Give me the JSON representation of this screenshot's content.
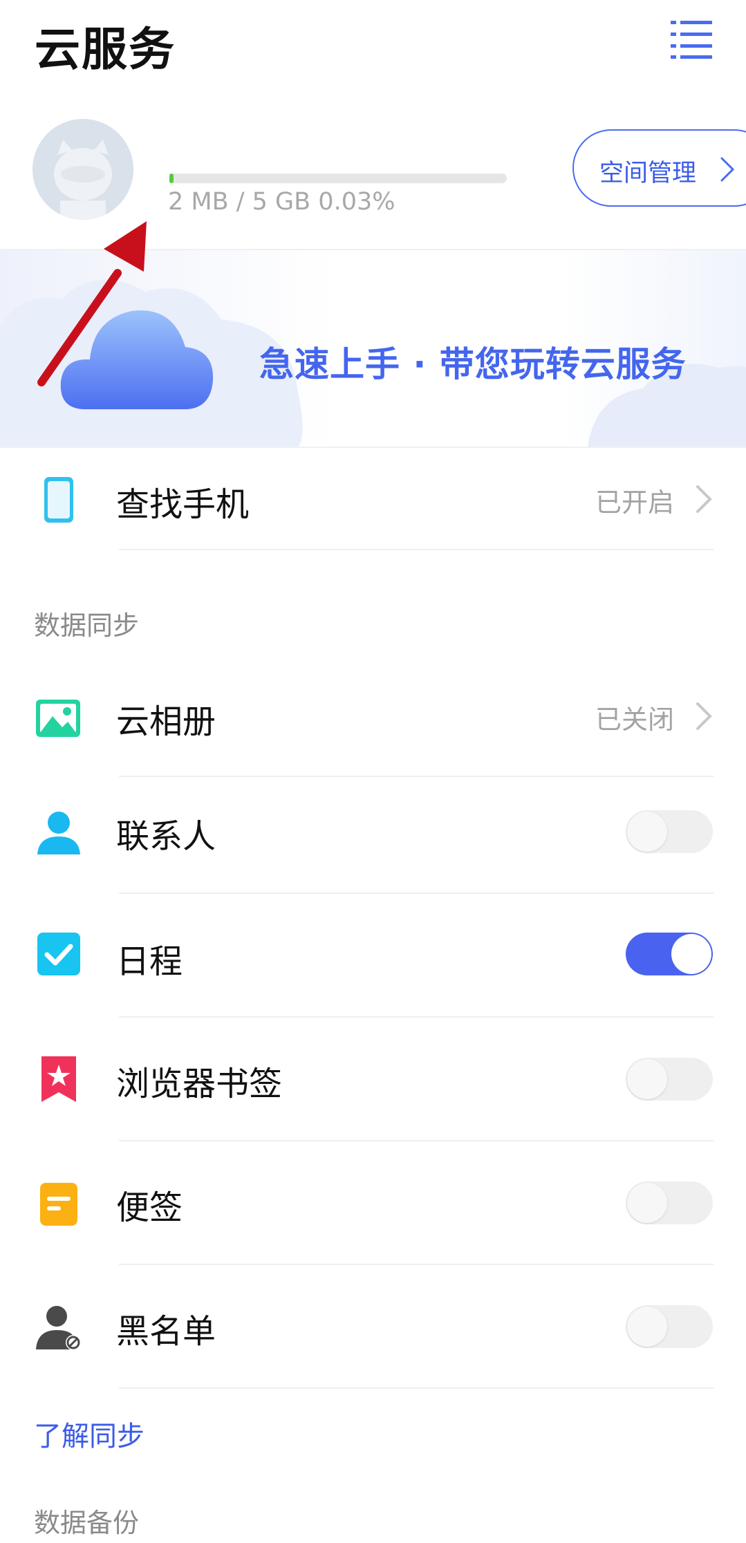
{
  "header": {
    "title": "云服务",
    "menu_icon": "list-menu-icon"
  },
  "account": {
    "avatar_icon": "default-avatar-icon",
    "storage_text": "2 MB / 5 GB 0.03%",
    "storage_fraction": 0.0003,
    "storage_color": "#5ac93c",
    "space_button_label": "空间管理"
  },
  "banner": {
    "text": "急速上手 · 带您玩转云服务",
    "icon": "cloud-icon"
  },
  "find_phone": {
    "label": "查找手机",
    "status": "已开启",
    "icon": "phone-icon"
  },
  "sync_section": {
    "title": "数据同步",
    "items": [
      {
        "label": "云相册",
        "status": "已关闭",
        "icon": "photo-album-icon"
      },
      {
        "label": "联系人",
        "toggle": false,
        "icon": "contact-person-icon"
      },
      {
        "label": "日程",
        "toggle": true,
        "icon": "calendar-check-icon"
      },
      {
        "label": "浏览器书签",
        "toggle": false,
        "icon": "bookmark-star-icon"
      },
      {
        "label": "便签",
        "toggle": false,
        "icon": "note-icon"
      },
      {
        "label": "黑名单",
        "toggle": false,
        "icon": "blacklist-person-icon"
      }
    ],
    "link": "了解同步"
  },
  "backup_section": {
    "title": "数据备份"
  },
  "colors": {
    "accent": "#4a62f0",
    "link": "#3b5ce8",
    "annotation_arrow": "#c8101c"
  }
}
